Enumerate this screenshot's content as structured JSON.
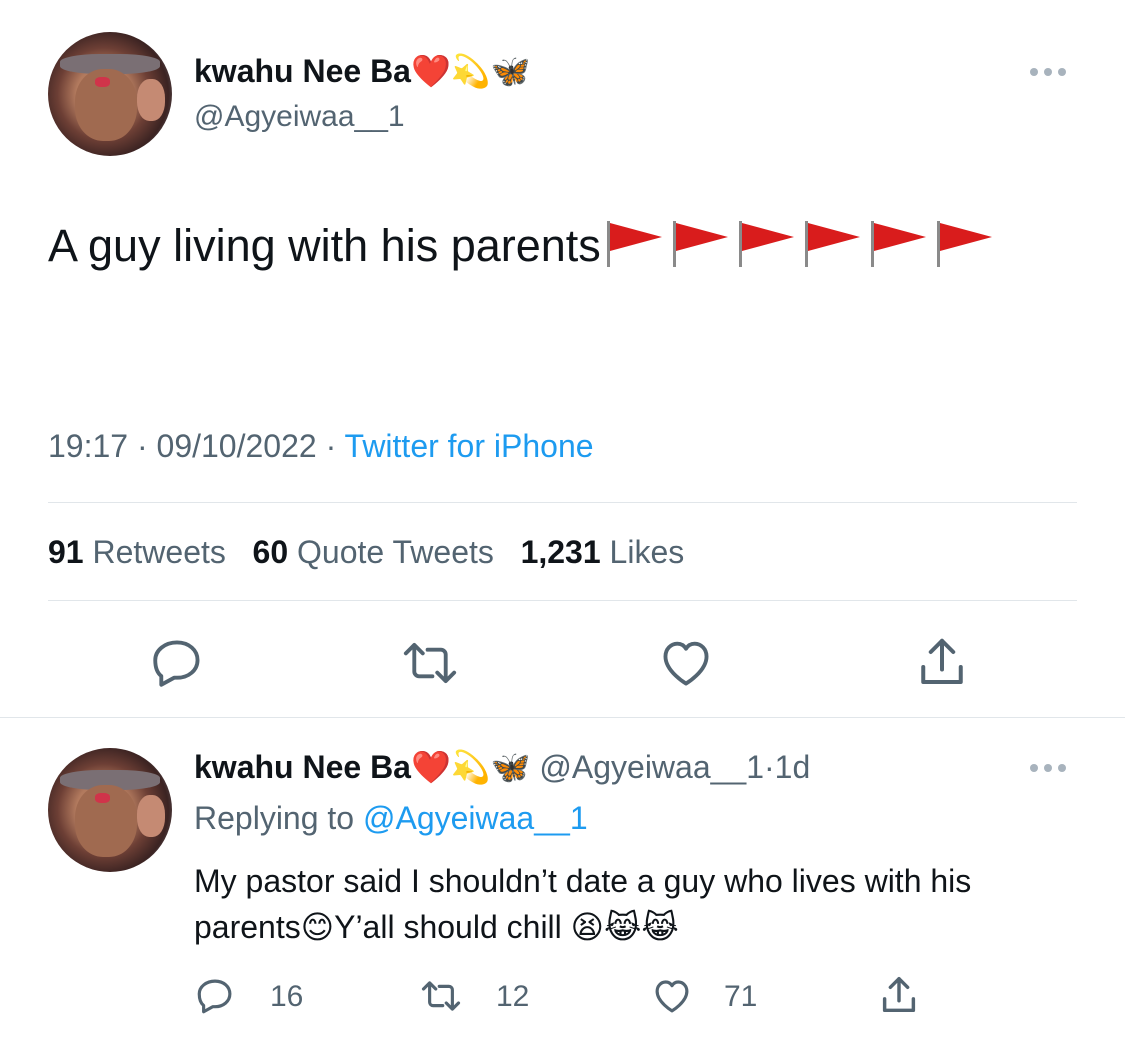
{
  "main_tweet": {
    "author_name": "kwahu Nee Ba",
    "author_emojis": "❤️💫🦋",
    "author_handle": "@Agyeiwaa__1",
    "text": "A guy living with his parents",
    "flag_count": 6,
    "time": "19:17",
    "date": "09/10/2022",
    "source": "Twitter for iPhone",
    "separator": "·",
    "stats": {
      "retweets_count": "91",
      "retweets_label": "Retweets",
      "quotes_count": "60",
      "quotes_label": "Quote Tweets",
      "likes_count": "1,231",
      "likes_label": "Likes"
    }
  },
  "reply": {
    "author_name": "kwahu Nee Ba",
    "author_emojis": "❤️💫🦋",
    "author_handle": "@Agyeiwaa__1",
    "age": "1d",
    "separator": "·",
    "replying_prefix": "Replying to",
    "replying_handle": "@Agyeiwaa__1",
    "text_line1": "My pastor said I shouldn’t date a guy who lives with his",
    "text_line2_a": "parents",
    "emoji_smile": "😊",
    "text_line2_b": "Y’all should chill",
    "emoji_tail": "😫😹😹",
    "counts": {
      "replies": "16",
      "retweets": "12",
      "likes": "71"
    }
  },
  "colors": {
    "text": "#0f1419",
    "secondary": "#536471",
    "link": "#1d9bf0",
    "divider": "#e1e6ea",
    "flag": "#d91c1c"
  },
  "icons": [
    "more-icon",
    "reply-icon",
    "retweet-icon",
    "like-icon",
    "share-icon",
    "red-flag-icon"
  ]
}
